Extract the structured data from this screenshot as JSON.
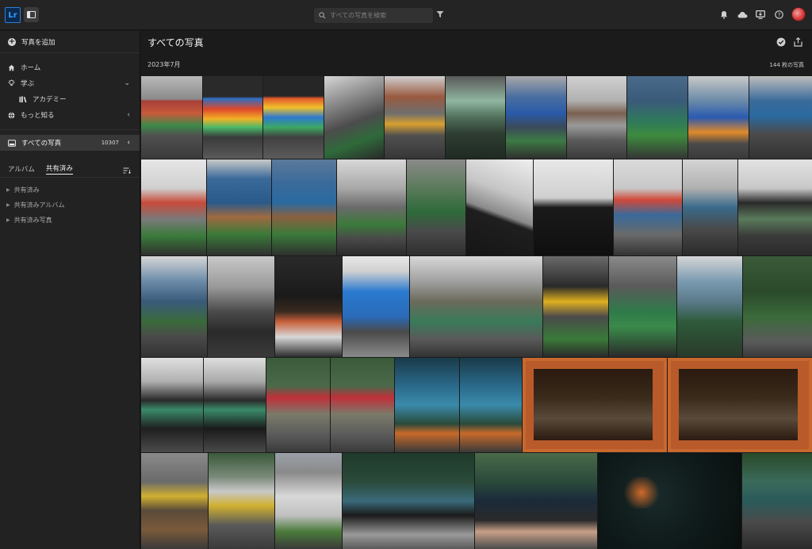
{
  "app": {
    "logo": "Lr"
  },
  "search": {
    "placeholder": "すべての写真を検索"
  },
  "topbar_icons": [
    "bell-icon",
    "cloud-icon",
    "whats-new-icon",
    "help-icon",
    "avatar"
  ],
  "sidebar": {
    "add_photo": "写真を追加",
    "nav": [
      {
        "label": "ホーム",
        "icon": "home-icon"
      },
      {
        "label": "学ぶ",
        "icon": "lightbulb-icon",
        "chevron": "⌄"
      },
      {
        "label": "アカデミー",
        "icon": "books-icon"
      },
      {
        "label": "もっと知る",
        "icon": "globe-icon",
        "chevron": "‹"
      }
    ],
    "all_photos": {
      "label": "すべての写真",
      "count": "10307",
      "chevron": "‹"
    },
    "tabs": {
      "album": "アルバム",
      "shared": "共有済み"
    },
    "shared_items": [
      "共有済み",
      "共有済みアルバム",
      "共有済み写真"
    ]
  },
  "main": {
    "title": "すべての写真",
    "date": "2023年7月",
    "count": "144 枚の写真"
  },
  "colors": {
    "accent": "#2f7fd6",
    "background": "#1b1b1b",
    "sidebar": "#222222",
    "selected": "#383838"
  }
}
